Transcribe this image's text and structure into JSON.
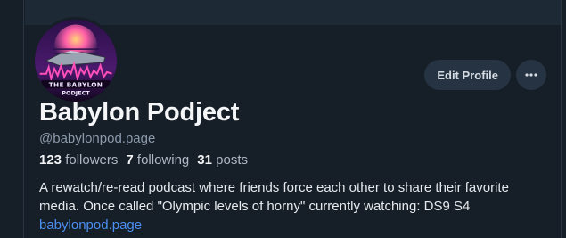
{
  "profile": {
    "display_name": "Babylon Podject",
    "handle": "@babylonpod.page",
    "followers_count": "123",
    "followers_label": "followers",
    "following_count": "7",
    "following_label": "following",
    "posts_count": "31",
    "posts_label": "posts",
    "bio_text": "A rewatch/re-read podcast where friends force each other to share their favorite media. Once called \"Olympic levels of horny\" currently watching: DS9 S4 ",
    "bio_link": "babylonpod.page",
    "avatar_text_line1": "THE BABYLON",
    "avatar_text_line2": "PODJECT"
  },
  "actions": {
    "edit_label": "Edit Profile",
    "more_icon": "ellipsis-icon"
  },
  "colors": {
    "background": "#161e27",
    "banner": "#1e2936",
    "button_bg": "#263342",
    "link": "#4a8ff0",
    "muted": "#8c9aab"
  }
}
